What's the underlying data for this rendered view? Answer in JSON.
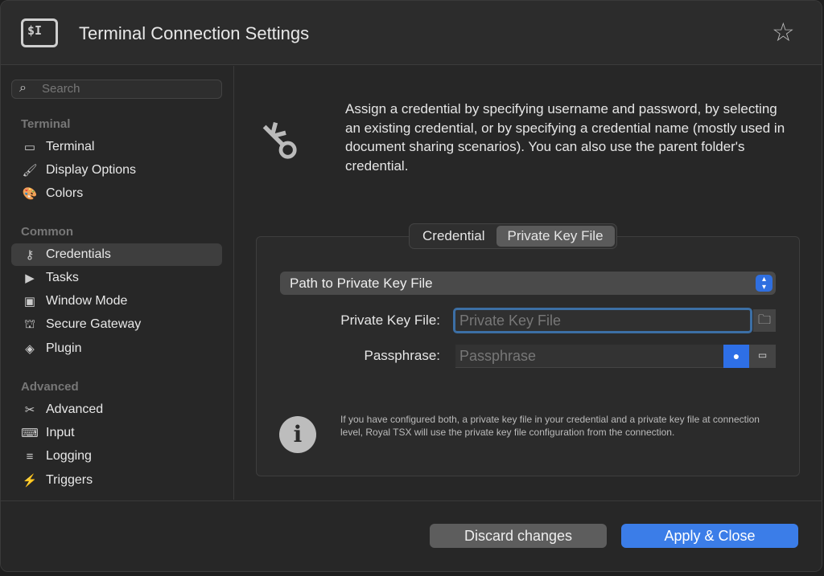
{
  "header": {
    "title": "Terminal Connection Settings",
    "app_icon": "$I"
  },
  "sidebar": {
    "search_placeholder": "Search",
    "sections": [
      {
        "title": "Terminal",
        "items": [
          {
            "label": "Terminal",
            "icon": "terminal-icon"
          },
          {
            "label": "Display Options",
            "icon": "brush-icon"
          },
          {
            "label": "Colors",
            "icon": "palette-icon"
          }
        ]
      },
      {
        "title": "Common",
        "items": [
          {
            "label": "Credentials",
            "icon": "key-icon"
          },
          {
            "label": "Tasks",
            "icon": "tasks-icon"
          },
          {
            "label": "Window Mode",
            "icon": "window-icon"
          },
          {
            "label": "Secure Gateway",
            "icon": "gateway-icon"
          },
          {
            "label": "Plugin",
            "icon": "plugin-icon"
          }
        ]
      },
      {
        "title": "Advanced",
        "items": [
          {
            "label": "Advanced",
            "icon": "tools-icon"
          },
          {
            "label": "Input",
            "icon": "keyboard-icon"
          },
          {
            "label": "Logging",
            "icon": "log-icon"
          },
          {
            "label": "Triggers",
            "icon": "trigger-icon"
          }
        ]
      }
    ],
    "selected": "Credentials"
  },
  "main": {
    "description": "Assign a credential by specifying username and password, by selecting an existing credential, or by specifying a credential name (mostly used in document sharing scenarios). You can also use the parent folder's credential.",
    "tabs": [
      {
        "label": "Credential"
      },
      {
        "label": "Private Key File",
        "active": true
      }
    ],
    "mode_select": "Path to Private Key File",
    "private_key_label": "Private Key File:",
    "private_key_placeholder": "Private Key File",
    "private_key_value": "",
    "passphrase_label": "Passphrase:",
    "passphrase_placeholder": "Passphrase",
    "passphrase_value": "",
    "note": "If you have configured both, a private key file in your credential and a private key file at connection level, Royal TSX will use the private key file configuration from the connection."
  },
  "footer": {
    "discard": "Discard changes",
    "apply": "Apply & Close"
  },
  "colors": {
    "accent": "#3b7de8",
    "focus_ring": "#3c6fa5"
  }
}
